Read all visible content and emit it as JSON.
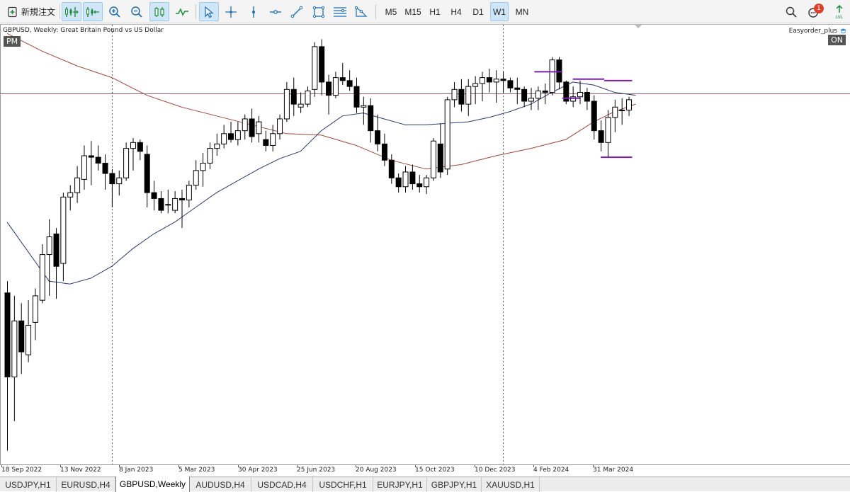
{
  "toolbar": {
    "new_order_label": "新規注文",
    "timeframes": [
      "M5",
      "M15",
      "H1",
      "H4",
      "D1",
      "W1",
      "MN"
    ],
    "active_timeframe": "W1",
    "notification_count": "1"
  },
  "chart": {
    "symbol_title": "GBPUSD, Weekly:  Great Britain Pound vs US Dollar",
    "pm_badge": "PM",
    "on_badge": "ON",
    "ea_label": "Easyorder_plus",
    "time_labels": [
      "18 Sep 2022",
      "13 Nov 2022",
      "8 Jan 2023",
      "5 Mar 2023",
      "30 Apr 2023",
      "25 Jun 2023",
      "20 Aug 2023",
      "15 Oct 2023",
      "10 Dec 2023",
      "4 Feb 2024",
      "31 Mar 2024"
    ],
    "colors": {
      "bull_body": "#ffffff",
      "bear_body": "#000000",
      "ma_fast": "#2b3a6b",
      "ma_slow": "#9b4a3a",
      "hline": "#8a6070",
      "marker": "#7a1fb0"
    }
  },
  "chart_data": {
    "type": "candlestick",
    "interval": "weekly",
    "candles": [
      {
        "o": 1.142,
        "h": 1.15,
        "l": 1.035,
        "c": 1.085
      },
      {
        "o": 1.085,
        "h": 1.14,
        "l": 1.055,
        "c": 1.123
      },
      {
        "o": 1.123,
        "h": 1.135,
        "l": 1.087,
        "c": 1.102
      },
      {
        "o": 1.1,
        "h": 1.137,
        "l": 1.095,
        "c": 1.12
      },
      {
        "o": 1.122,
        "h": 1.145,
        "l": 1.11,
        "c": 1.14
      },
      {
        "o": 1.137,
        "h": 1.175,
        "l": 1.135,
        "c": 1.168
      },
      {
        "o": 1.168,
        "h": 1.192,
        "l": 1.14,
        "c": 1.18
      },
      {
        "o": 1.182,
        "h": 1.186,
        "l": 1.138,
        "c": 1.16
      },
      {
        "o": 1.162,
        "h": 1.21,
        "l": 1.15,
        "c": 1.207
      },
      {
        "o": 1.207,
        "h": 1.215,
        "l": 1.198,
        "c": 1.21
      },
      {
        "o": 1.21,
        "h": 1.228,
        "l": 1.203,
        "c": 1.22
      },
      {
        "o": 1.219,
        "h": 1.242,
        "l": 1.212,
        "c": 1.235
      },
      {
        "o": 1.235,
        "h": 1.245,
        "l": 1.215,
        "c": 1.234
      },
      {
        "o": 1.234,
        "h": 1.242,
        "l": 1.225,
        "c": 1.23
      },
      {
        "o": 1.23,
        "h": 1.236,
        "l": 1.212,
        "c": 1.223
      },
      {
        "o": 1.223,
        "h": 1.226,
        "l": 1.2,
        "c": 1.216
      },
      {
        "o": 1.216,
        "h": 1.225,
        "l": 1.208,
        "c": 1.22
      },
      {
        "o": 1.22,
        "h": 1.244,
        "l": 1.218,
        "c": 1.24
      },
      {
        "o": 1.24,
        "h": 1.247,
        "l": 1.225,
        "c": 1.244
      },
      {
        "o": 1.244,
        "h": 1.246,
        "l": 1.232,
        "c": 1.238
      },
      {
        "o": 1.236,
        "h": 1.242,
        "l": 1.2,
        "c": 1.21
      },
      {
        "o": 1.21,
        "h": 1.218,
        "l": 1.198,
        "c": 1.206
      },
      {
        "o": 1.206,
        "h": 1.211,
        "l": 1.196,
        "c": 1.198
      },
      {
        "o": 1.202,
        "h": 1.212,
        "l": 1.196,
        "c": 1.202
      },
      {
        "o": 1.198,
        "h": 1.211,
        "l": 1.196,
        "c": 1.206
      },
      {
        "o": 1.206,
        "h": 1.212,
        "l": 1.186,
        "c": 1.205
      },
      {
        "o": 1.205,
        "h": 1.218,
        "l": 1.2,
        "c": 1.215
      },
      {
        "o": 1.215,
        "h": 1.232,
        "l": 1.212,
        "c": 1.225
      },
      {
        "o": 1.225,
        "h": 1.237,
        "l": 1.214,
        "c": 1.23
      },
      {
        "o": 1.23,
        "h": 1.244,
        "l": 1.226,
        "c": 1.24
      },
      {
        "o": 1.24,
        "h": 1.25,
        "l": 1.235,
        "c": 1.243
      },
      {
        "o": 1.243,
        "h": 1.256,
        "l": 1.24,
        "c": 1.25
      },
      {
        "o": 1.25,
        "h": 1.258,
        "l": 1.244,
        "c": 1.246
      },
      {
        "o": 1.246,
        "h": 1.258,
        "l": 1.242,
        "c": 1.252
      },
      {
        "o": 1.252,
        "h": 1.263,
        "l": 1.246,
        "c": 1.26
      },
      {
        "o": 1.26,
        "h": 1.267,
        "l": 1.244,
        "c": 1.248
      },
      {
        "o": 1.25,
        "h": 1.262,
        "l": 1.244,
        "c": 1.258
      },
      {
        "o": 1.246,
        "h": 1.252,
        "l": 1.238,
        "c": 1.242
      },
      {
        "o": 1.242,
        "h": 1.256,
        "l": 1.238,
        "c": 1.25
      },
      {
        "o": 1.25,
        "h": 1.263,
        "l": 1.246,
        "c": 1.26
      },
      {
        "o": 1.26,
        "h": 1.285,
        "l": 1.258,
        "c": 1.28
      },
      {
        "o": 1.28,
        "h": 1.288,
        "l": 1.262,
        "c": 1.27
      },
      {
        "o": 1.268,
        "h": 1.278,
        "l": 1.264,
        "c": 1.27
      },
      {
        "o": 1.27,
        "h": 1.282,
        "l": 1.268,
        "c": 1.279
      },
      {
        "o": 1.28,
        "h": 1.312,
        "l": 1.275,
        "c": 1.309
      },
      {
        "o": 1.309,
        "h": 1.314,
        "l": 1.276,
        "c": 1.285
      },
      {
        "o": 1.285,
        "h": 1.29,
        "l": 1.263,
        "c": 1.276
      },
      {
        "o": 1.276,
        "h": 1.292,
        "l": 1.274,
        "c": 1.288
      },
      {
        "o": 1.288,
        "h": 1.298,
        "l": 1.283,
        "c": 1.286
      },
      {
        "o": 1.286,
        "h": 1.293,
        "l": 1.279,
        "c": 1.282
      },
      {
        "o": 1.282,
        "h": 1.288,
        "l": 1.264,
        "c": 1.268
      },
      {
        "o": 1.268,
        "h": 1.275,
        "l": 1.256,
        "c": 1.269
      },
      {
        "o": 1.269,
        "h": 1.274,
        "l": 1.244,
        "c": 1.252
      },
      {
        "o": 1.252,
        "h": 1.263,
        "l": 1.238,
        "c": 1.243
      },
      {
        "o": 1.243,
        "h": 1.25,
        "l": 1.228,
        "c": 1.232
      },
      {
        "o": 1.232,
        "h": 1.236,
        "l": 1.216,
        "c": 1.22
      },
      {
        "o": 1.22,
        "h": 1.223,
        "l": 1.21,
        "c": 1.214
      },
      {
        "o": 1.214,
        "h": 1.228,
        "l": 1.21,
        "c": 1.224
      },
      {
        "o": 1.224,
        "h": 1.229,
        "l": 1.212,
        "c": 1.216
      },
      {
        "o": 1.216,
        "h": 1.222,
        "l": 1.21,
        "c": 1.214
      },
      {
        "o": 1.214,
        "h": 1.222,
        "l": 1.209,
        "c": 1.22
      },
      {
        "o": 1.22,
        "h": 1.247,
        "l": 1.218,
        "c": 1.245
      },
      {
        "o": 1.243,
        "h": 1.257,
        "l": 1.22,
        "c": 1.224
      },
      {
        "o": 1.226,
        "h": 1.275,
        "l": 1.222,
        "c": 1.273
      },
      {
        "o": 1.273,
        "h": 1.285,
        "l": 1.268,
        "c": 1.28
      },
      {
        "o": 1.28,
        "h": 1.287,
        "l": 1.265,
        "c": 1.27
      },
      {
        "o": 1.27,
        "h": 1.287,
        "l": 1.262,
        "c": 1.282
      },
      {
        "o": 1.282,
        "h": 1.289,
        "l": 1.27,
        "c": 1.284
      },
      {
        "o": 1.284,
        "h": 1.292,
        "l": 1.272,
        "c": 1.288
      },
      {
        "o": 1.288,
        "h": 1.294,
        "l": 1.278,
        "c": 1.285
      },
      {
        "o": 1.285,
        "h": 1.293,
        "l": 1.271,
        "c": 1.287
      },
      {
        "o": 1.287,
        "h": 1.292,
        "l": 1.278,
        "c": 1.286
      },
      {
        "o": 1.286,
        "h": 1.288,
        "l": 1.278,
        "c": 1.281
      },
      {
        "o": 1.281,
        "h": 1.288,
        "l": 1.27,
        "c": 1.28
      },
      {
        "o": 1.28,
        "h": 1.282,
        "l": 1.268,
        "c": 1.272
      },
      {
        "o": 1.272,
        "h": 1.281,
        "l": 1.266,
        "c": 1.274
      },
      {
        "o": 1.274,
        "h": 1.282,
        "l": 1.266,
        "c": 1.279
      },
      {
        "o": 1.279,
        "h": 1.284,
        "l": 1.27,
        "c": 1.278
      },
      {
        "o": 1.278,
        "h": 1.302,
        "l": 1.276,
        "c": 1.3
      },
      {
        "o": 1.3,
        "h": 1.302,
        "l": 1.28,
        "c": 1.285
      },
      {
        "o": 1.285,
        "h": 1.286,
        "l": 1.27,
        "c": 1.272
      },
      {
        "o": 1.272,
        "h": 1.282,
        "l": 1.268,
        "c": 1.275
      },
      {
        "o": 1.275,
        "h": 1.286,
        "l": 1.27,
        "c": 1.278
      },
      {
        "o": 1.278,
        "h": 1.281,
        "l": 1.266,
        "c": 1.272
      },
      {
        "o": 1.272,
        "h": 1.276,
        "l": 1.246,
        "c": 1.252
      },
      {
        "o": 1.252,
        "h": 1.259,
        "l": 1.238,
        "c": 1.244
      },
      {
        "o": 1.244,
        "h": 1.266,
        "l": 1.234,
        "c": 1.261
      },
      {
        "o": 1.261,
        "h": 1.273,
        "l": 1.251,
        "c": 1.268
      },
      {
        "o": 1.266,
        "h": 1.274,
        "l": 1.256,
        "c": 1.266
      },
      {
        "o": 1.266,
        "h": 1.275,
        "l": 1.262,
        "c": 1.273
      }
    ],
    "ma_fast": [
      [
        0,
        1.19
      ],
      [
        3,
        1.17
      ],
      [
        6,
        1.15
      ],
      [
        9,
        1.148
      ],
      [
        12,
        1.152
      ],
      [
        15,
        1.16
      ],
      [
        18,
        1.172
      ],
      [
        21,
        1.182
      ],
      [
        24,
        1.19
      ],
      [
        27,
        1.2
      ],
      [
        30,
        1.21
      ],
      [
        33,
        1.218
      ],
      [
        36,
        1.226
      ],
      [
        39,
        1.233
      ],
      [
        42,
        1.238
      ],
      [
        45,
        1.252
      ],
      [
        48,
        1.262
      ],
      [
        51,
        1.264
      ],
      [
        54,
        1.26
      ],
      [
        57,
        1.256
      ],
      [
        60,
        1.256
      ],
      [
        63,
        1.257
      ],
      [
        66,
        1.258
      ],
      [
        69,
        1.261
      ],
      [
        72,
        1.265
      ],
      [
        75,
        1.27
      ],
      [
        78,
        1.278
      ],
      [
        81,
        1.285
      ],
      [
        84,
        1.283
      ],
      [
        87,
        1.278
      ],
      [
        90,
        1.276
      ]
    ],
    "ma_slow": [
      [
        0,
        1.318
      ],
      [
        5,
        1.306
      ],
      [
        10,
        1.296
      ],
      [
        15,
        1.288
      ],
      [
        20,
        1.276
      ],
      [
        25,
        1.268
      ],
      [
        30,
        1.262
      ],
      [
        35,
        1.256
      ],
      [
        40,
        1.25
      ],
      [
        45,
        1.249
      ],
      [
        50,
        1.242
      ],
      [
        55,
        1.232
      ],
      [
        60,
        1.226
      ],
      [
        65,
        1.229
      ],
      [
        70,
        1.235
      ],
      [
        75,
        1.24
      ],
      [
        80,
        1.246
      ],
      [
        84,
        1.258
      ],
      [
        87,
        1.265
      ],
      [
        90,
        1.27
      ]
    ],
    "horizontal_level": 1.277,
    "marker_segments": [
      {
        "i1": 75.5,
        "i2": 79.5,
        "y": 1.292
      },
      {
        "i1": 79.5,
        "i2": 82,
        "y": 1.274
      },
      {
        "i1": 81,
        "i2": 85.5,
        "y": 1.287
      },
      {
        "i1": 85,
        "i2": 89.5,
        "y": 1.234
      },
      {
        "i1": 85.5,
        "i2": 89.5,
        "y": 1.286
      }
    ],
    "separators_at_index": [
      15,
      71
    ],
    "xlim": [
      0,
      91
    ],
    "ylim": [
      1.03,
      1.32
    ]
  },
  "tabs": {
    "items": [
      "USDJPY,H1",
      "EURUSD,H4",
      "GBPUSD,Weekly",
      "AUDUSD,H4",
      "USDCAD,H4",
      "USDCHF,H1",
      "EURJPY,H1",
      "GBPJPY,H1",
      "XAUUSD,H1"
    ],
    "active": "GBPUSD,Weekly"
  }
}
